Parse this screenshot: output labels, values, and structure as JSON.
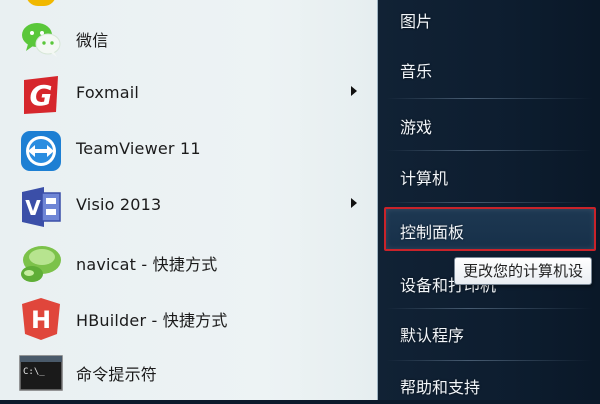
{
  "programs": [
    {
      "label": "微信",
      "icon": "wechat-icon",
      "has_submenu": false
    },
    {
      "label": "Foxmail",
      "icon": "foxmail-icon",
      "has_submenu": true
    },
    {
      "label": "TeamViewer 11",
      "icon": "teamviewer-icon",
      "has_submenu": false
    },
    {
      "label": "Visio 2013",
      "icon": "visio-icon",
      "has_submenu": true
    },
    {
      "label": "navicat - 快捷方式",
      "icon": "navicat-icon",
      "has_submenu": false
    },
    {
      "label": "HBuilder - 快捷方式",
      "icon": "hbuilder-icon",
      "has_submenu": false
    },
    {
      "label": "命令提示符",
      "icon": "command-prompt-icon",
      "has_submenu": false
    }
  ],
  "right_items": [
    {
      "label": "图片"
    },
    {
      "label": "音乐"
    },
    {
      "label": "游戏"
    },
    {
      "label": "计算机"
    },
    {
      "label": "控制面板",
      "highlighted": true
    },
    {
      "label": "设备和打印机"
    },
    {
      "label": "默认程序"
    },
    {
      "label": "帮助和支持"
    }
  ],
  "tooltip": "更改您的计算机设",
  "icon_glyphs": {
    "foxmail": "G",
    "visio": "V",
    "hbuilder": "H",
    "cmd": "C:\\_"
  },
  "colors": {
    "highlight_border": "#c9232a",
    "wechat_green": "#5ac73a",
    "foxmail_red": "#d6262c",
    "teamviewer_blue": "#1d7fd3",
    "visio_blue": "#3b4fa8",
    "navicat_green": "#7cc24a",
    "hbuilder_red": "#e0463b"
  }
}
